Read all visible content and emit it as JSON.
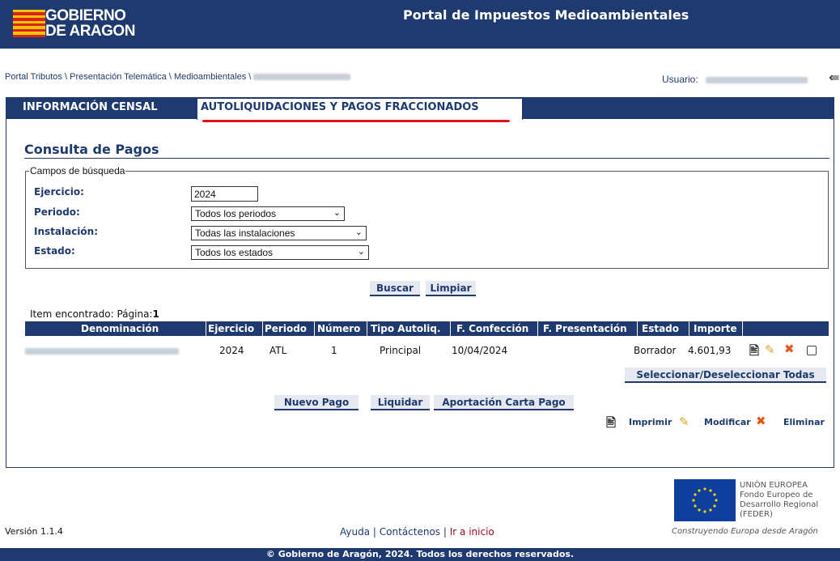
{
  "header": {
    "logo_line1": "GOBIERNO",
    "logo_line2": "DE ARAGON",
    "title": "Portal de Impuestos Medioambientales"
  },
  "breadcrumb": {
    "items": [
      "Portal Tributos",
      "Presentación Telemática",
      "Medioambientales"
    ],
    "separator": "\\"
  },
  "user": {
    "label": "Usuario:"
  },
  "tabs": {
    "censal": "INFORMACIÓN CENSAL",
    "autoliquidaciones": "AUTOLIQUIDACIONES Y PAGOS FRACCIONADOS"
  },
  "page": {
    "title": "Consulta de Pagos"
  },
  "search": {
    "legend": "Campos de búsqueda",
    "ejercicio_label": "Ejercicio:",
    "ejercicio_value": "2024",
    "periodo_label": "Periodo:",
    "periodo_value": "Todos los periodos",
    "instalacion_label": "Instalación:",
    "instalacion_value": "Todas las instalaciones",
    "estado_label": "Estado:",
    "estado_value": "Todos los estados",
    "buscar": "Buscar",
    "limpiar": "Limpiar"
  },
  "results": {
    "found_text": "Item encontrado: Página:",
    "page_number": "1",
    "columns": [
      "Denominación",
      "Ejercicio",
      "Periodo",
      "Número",
      "Tipo Autoliq.",
      "F. Confección",
      "F. Presentación",
      "Estado",
      "Importe"
    ],
    "rows": [
      {
        "ejercicio": "2024",
        "periodo": "ATL",
        "numero": "1",
        "tipo": "Principal",
        "f_confeccion": "10/04/2024",
        "f_presentacion": "",
        "estado": "Borrador",
        "importe": "4.601,93"
      }
    ],
    "select_all": "Seleccionar/Deseleccionar Todas"
  },
  "actions": {
    "nuevo_pago": "Nuevo Pago",
    "liquidar": "Liquidar",
    "aportacion": "Aportación Carta Pago"
  },
  "legend": {
    "imprimir": "Imprimir",
    "modificar": "Modificar",
    "eliminar": "Eliminar"
  },
  "footer": {
    "version": "Versión 1.1.4",
    "ayuda": "Ayuda",
    "contactenos": "Contáctenos",
    "ir_inicio": "Ir a inicio",
    "link_sep": "|",
    "eu_line1": "UNIÓN EUROPEA",
    "eu_line2": "Fondo Europeo de",
    "eu_line3": "Desarrollo Regional",
    "eu_line4": "(FEDER)",
    "eu_slogan": "Construyendo Europa desde Aragón",
    "copyright": "© Gobierno de Aragón, 2024. Todos los derechos reservados."
  },
  "colors": {
    "primary": "#1f3a6e",
    "accent_red": "#e0141e",
    "flag_yellow": "#f5c400",
    "flag_red": "#d8231e"
  }
}
